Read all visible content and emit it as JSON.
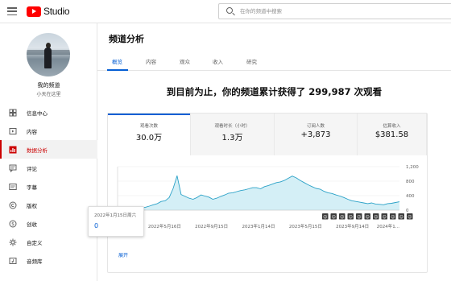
{
  "header": {
    "logo_text": "Studio",
    "search_placeholder": "在你的频道中搜索"
  },
  "sidebar": {
    "channel_name": "我的频道",
    "channel_handle": "小天在这里",
    "items": [
      {
        "label": "信息中心",
        "icon": "dashboard-icon",
        "active": false
      },
      {
        "label": "内容",
        "icon": "content-icon",
        "active": false
      },
      {
        "label": "数据分析",
        "icon": "analytics-icon",
        "active": true
      },
      {
        "label": "评论",
        "icon": "comments-icon",
        "active": false
      },
      {
        "label": "字幕",
        "icon": "subtitles-icon",
        "active": false
      },
      {
        "label": "版权",
        "icon": "copyright-icon",
        "active": false
      },
      {
        "label": "创收",
        "icon": "monetization-icon",
        "active": false
      },
      {
        "label": "自定义",
        "icon": "customization-icon",
        "active": false
      },
      {
        "label": "音频库",
        "icon": "audio-library-icon",
        "active": false
      }
    ]
  },
  "main": {
    "title": "频道分析",
    "tabs": [
      {
        "label": "概览",
        "active": true
      },
      {
        "label": "内容",
        "active": false
      },
      {
        "label": "观众",
        "active": false
      },
      {
        "label": "收入",
        "active": false
      },
      {
        "label": "研究",
        "active": false
      }
    ],
    "headline": "到目前为止，你的频道累计获得了 299,987 次观看",
    "metrics": [
      {
        "label": "观看次数",
        "value": "30.0万",
        "selected": true
      },
      {
        "label": "观看时长（小时）",
        "value": "1.3万",
        "selected": false
      },
      {
        "label": "订阅人数",
        "value": "+3,873",
        "selected": false
      },
      {
        "label": "估算收入",
        "value": "$381.58",
        "selected": false
      }
    ],
    "tooltip": {
      "date": "2022年1月15日周六",
      "value": "0"
    },
    "expand_label": "展开"
  },
  "chart_data": {
    "type": "area",
    "ylim": [
      0,
      1200
    ],
    "y_ticks": [
      "1,200",
      "800",
      "400",
      "0"
    ],
    "x_ticks": [
      "2022年1...",
      "2022年5月16日",
      "2022年9月15日",
      "2023年1月14日",
      "2023年5月15日",
      "2023年9月14日",
      "2024年1..."
    ],
    "line_color": "#2aa1c7",
    "fill_color": "#d4eff6",
    "series": [
      {
        "values": [
          0,
          20,
          25,
          30,
          45,
          60,
          70,
          80,
          110,
          150,
          180,
          240,
          260,
          350,
          600,
          950,
          430,
          380,
          330,
          300,
          350,
          420,
          390,
          360,
          300,
          330,
          380,
          420,
          470,
          480,
          510,
          540,
          560,
          590,
          620,
          620,
          590,
          650,
          680,
          720,
          760,
          780,
          820,
          880,
          940,
          890,
          820,
          760,
          700,
          650,
          600,
          580,
          520,
          480,
          460,
          420,
          390,
          350,
          300,
          260,
          240,
          220,
          200,
          180,
          200,
          170,
          160,
          150,
          180,
          190,
          210,
          230
        ]
      }
    ],
    "annotation_markers": [
      "☺",
      "☺",
      "☺",
      "☺",
      "☺",
      "☺",
      "☺",
      "☺",
      "☺",
      "☺",
      "☺"
    ]
  }
}
